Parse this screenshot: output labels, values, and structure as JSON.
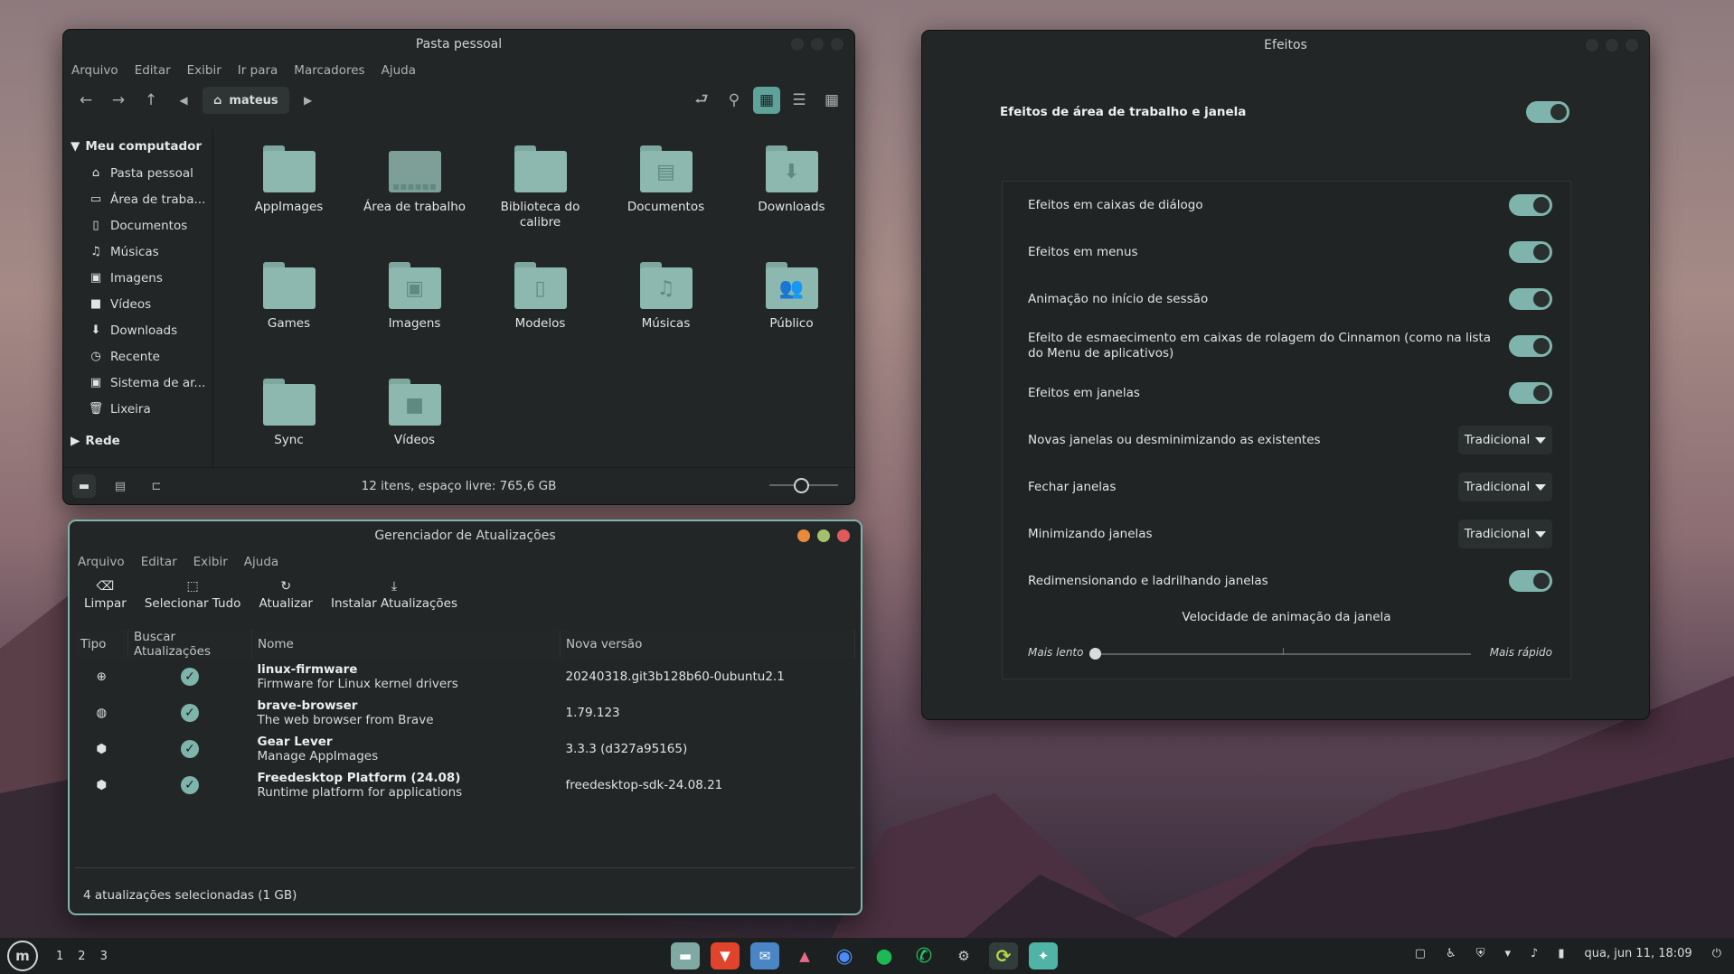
{
  "file_manager": {
    "title": "Pasta pessoal",
    "menu": [
      "Arquivo",
      "Editar",
      "Exibir",
      "Ir para",
      "Marcadores",
      "Ajuda"
    ],
    "path_label": "mateus",
    "sidebar": {
      "my_computer": "Meu computador",
      "items": [
        "Pasta pessoal",
        "Área de traba...",
        "Documentos",
        "Músicas",
        "Imagens",
        "Vídeos",
        "Downloads",
        "Recente",
        "Sistema de ar...",
        "Lixeira"
      ],
      "network": "Rede"
    },
    "folders": [
      "AppImages",
      "Área de trabalho",
      "Biblioteca do calibre",
      "Documentos",
      "Downloads",
      "Games",
      "Imagens",
      "Modelos",
      "Músicas",
      "Público",
      "Sync",
      "Vídeos"
    ],
    "status": "12 itens, espaço livre: 765,6 GB",
    "zoom_level": 0.45
  },
  "update_manager": {
    "title": "Gerenciador de Atualizações",
    "menu": [
      "Arquivo",
      "Editar",
      "Exibir",
      "Ajuda"
    ],
    "toolbar": [
      "Limpar",
      "Selecionar Tudo",
      "Atualizar",
      "Instalar Atualizações"
    ],
    "columns": [
      "Tipo",
      "Buscar Atualizações",
      "Nome",
      "Nova versão"
    ],
    "rows": [
      {
        "name": "linux-firmware",
        "desc": "Firmware for Linux kernel drivers",
        "version": "20240318.git3b128b60-0ubuntu2.1"
      },
      {
        "name": "brave-browser",
        "desc": "The web browser from Brave",
        "version": "1.79.123"
      },
      {
        "name": "Gear Lever",
        "desc": "Manage AppImages",
        "version": "3.3.3 (d327a95165)"
      },
      {
        "name": "Freedesktop Platform (24.08)",
        "desc": "Runtime platform for applications",
        "version": "freedesktop-sdk-24.08.21"
      }
    ],
    "status": "4 atualizações selecionadas (1 GB)"
  },
  "effects": {
    "title": "Efeitos",
    "main_label": "Efeitos de área de trabalho e janela",
    "rows": [
      {
        "label": "Efeitos em caixas de diálogo",
        "kind": "toggle"
      },
      {
        "label": "Efeitos em menus",
        "kind": "toggle"
      },
      {
        "label": "Animação no início de sessão",
        "kind": "toggle"
      },
      {
        "label": "Efeito de esmaecimento em caixas de rolagem do Cinnamon (como na lista do Menu de aplicativos)",
        "kind": "toggle"
      },
      {
        "label": "Efeitos em janelas",
        "kind": "toggle"
      },
      {
        "label": "Novas janelas ou desminimizando as existentes",
        "kind": "combo",
        "value": "Tradicional"
      },
      {
        "label": "Fechar janelas",
        "kind": "combo",
        "value": "Tradicional"
      },
      {
        "label": "Minimizando janelas",
        "kind": "combo",
        "value": "Tradicional"
      },
      {
        "label": "Redimensionando e ladrilhando janelas",
        "kind": "toggle"
      }
    ],
    "speed_title": "Velocidade de animação da janela",
    "slower": "Mais lento",
    "faster": "Mais rápido",
    "speed_value": 0.0
  },
  "panel": {
    "workspaces": [
      "1",
      "2",
      "3"
    ],
    "clock": "qua, jun 11, 18:09",
    "apps": [
      "files",
      "brave",
      "thunderbird",
      "pinta",
      "chrome",
      "spotify",
      "whatsapp",
      "settings",
      "update-manager",
      "software"
    ],
    "colors": {
      "accent": "#7fb4ac",
      "brave": "#e0442c",
      "chrome": "#4c8bf5",
      "spotify": "#1db954",
      "whatsapp": "#25d366"
    }
  }
}
